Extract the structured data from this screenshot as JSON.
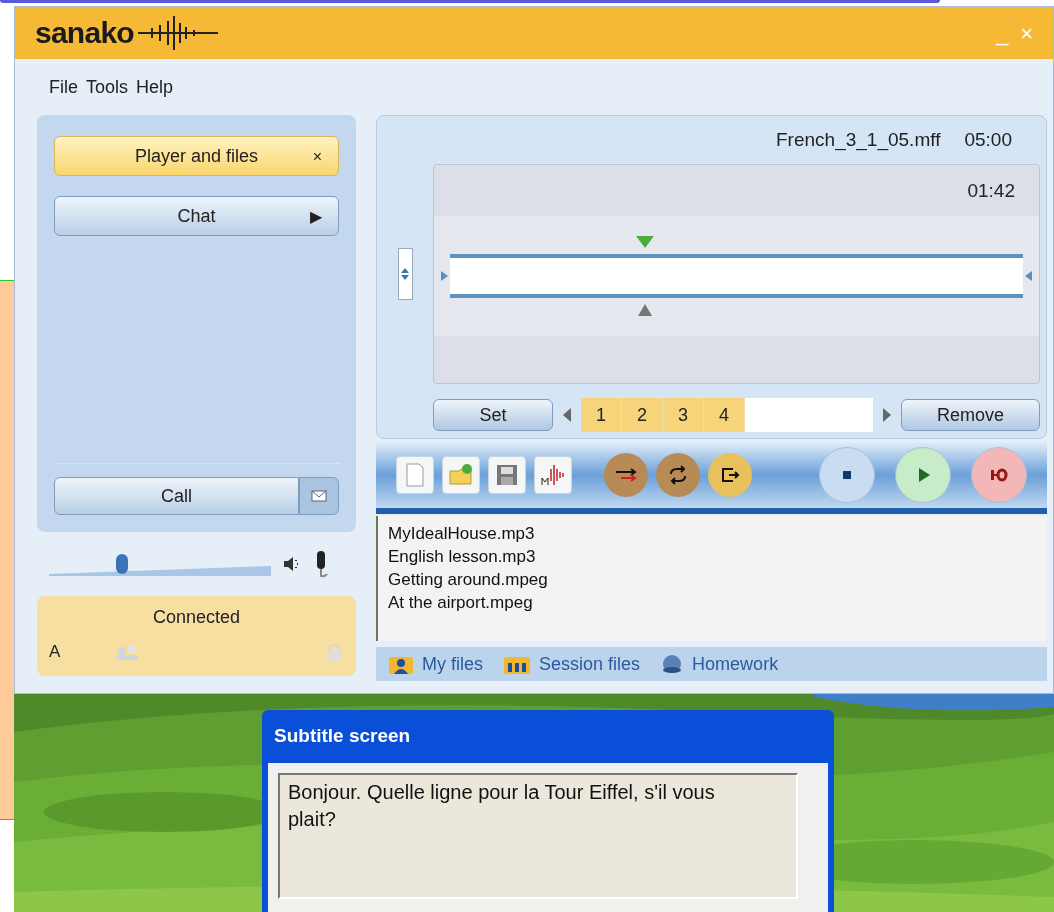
{
  "app": {
    "logo": "sanako",
    "window_controls": [
      "_",
      "×"
    ]
  },
  "menu": [
    "File",
    "Tools",
    "Help"
  ],
  "side_buttons": [
    {
      "label": "Player and files",
      "glyph": "×",
      "selected": true
    },
    {
      "label": "Chat",
      "glyph": "▶",
      "selected": false
    }
  ],
  "call_button": {
    "label": "Call"
  },
  "volume": {
    "level": 0.33
  },
  "status": {
    "label": "Connected",
    "line": "A"
  },
  "player": {
    "filename": "French_3_1_05.mff",
    "duration": "05:00",
    "position_time": "01:42",
    "position": {
      "level": 0.34
    }
  },
  "bookmarks": {
    "set_label": "Set",
    "remove_label": "Remove",
    "items": [
      "1",
      "2",
      "3",
      "4"
    ]
  },
  "transport": [
    {
      "kind": "stop"
    },
    {
      "kind": "play"
    },
    {
      "kind": "record"
    }
  ],
  "files": [
    "MyIdealHouse.mp3",
    "English lesson.mp3",
    "Getting around.mpeg",
    "At the airport.mpeg"
  ],
  "file_tabs": [
    {
      "label": "My files",
      "kind": "personal"
    },
    {
      "label": "Session files",
      "kind": "session"
    },
    {
      "label": "Homework",
      "kind": "homework"
    }
  ],
  "subtitle": {
    "title": "Subtitle screen",
    "text": "Bonjour. Quelle ligne pour la Tour Eiffel, s'il vous plait?"
  }
}
